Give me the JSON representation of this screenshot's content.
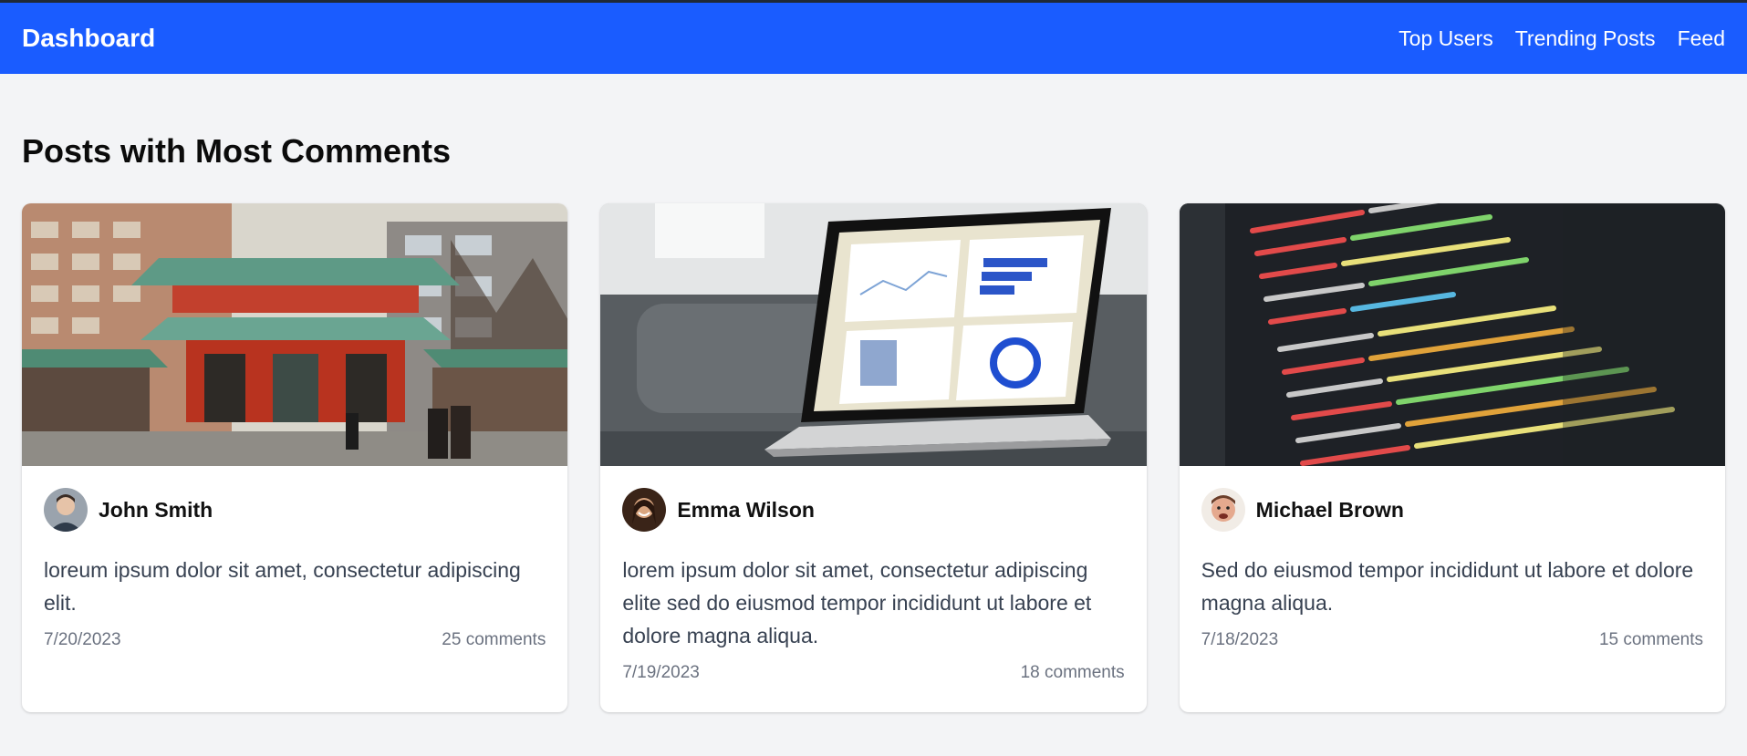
{
  "navbar": {
    "brand": "Dashboard",
    "links": [
      "Top Users",
      "Trending Posts",
      "Feed"
    ]
  },
  "main": {
    "title": "Posts with Most Comments",
    "posts": [
      {
        "author": "John Smith",
        "text": "loreum ipsum dolor sit amet, consectetur adipiscing elit.",
        "date": "7/20/2023",
        "comments": "25 comments",
        "image": "temple-gate-photo"
      },
      {
        "author": "Emma Wilson",
        "text": "lorem ipsum dolor sit amet, consectetur adipiscing elite sed do eiusmod tempor incididunt ut labore et dolore magna aliqua.",
        "date": "7/19/2023",
        "comments": "18 comments",
        "image": "laptop-dashboard-photo"
      },
      {
        "author": "Michael Brown",
        "text": "Sed do eiusmod tempor incididunt ut labore et dolore magna aliqua.",
        "date": "7/18/2023",
        "comments": "15 comments",
        "image": "code-screen-photo"
      }
    ]
  },
  "colors": {
    "navbar": "#1a5cff",
    "background": "#f3f4f6"
  }
}
